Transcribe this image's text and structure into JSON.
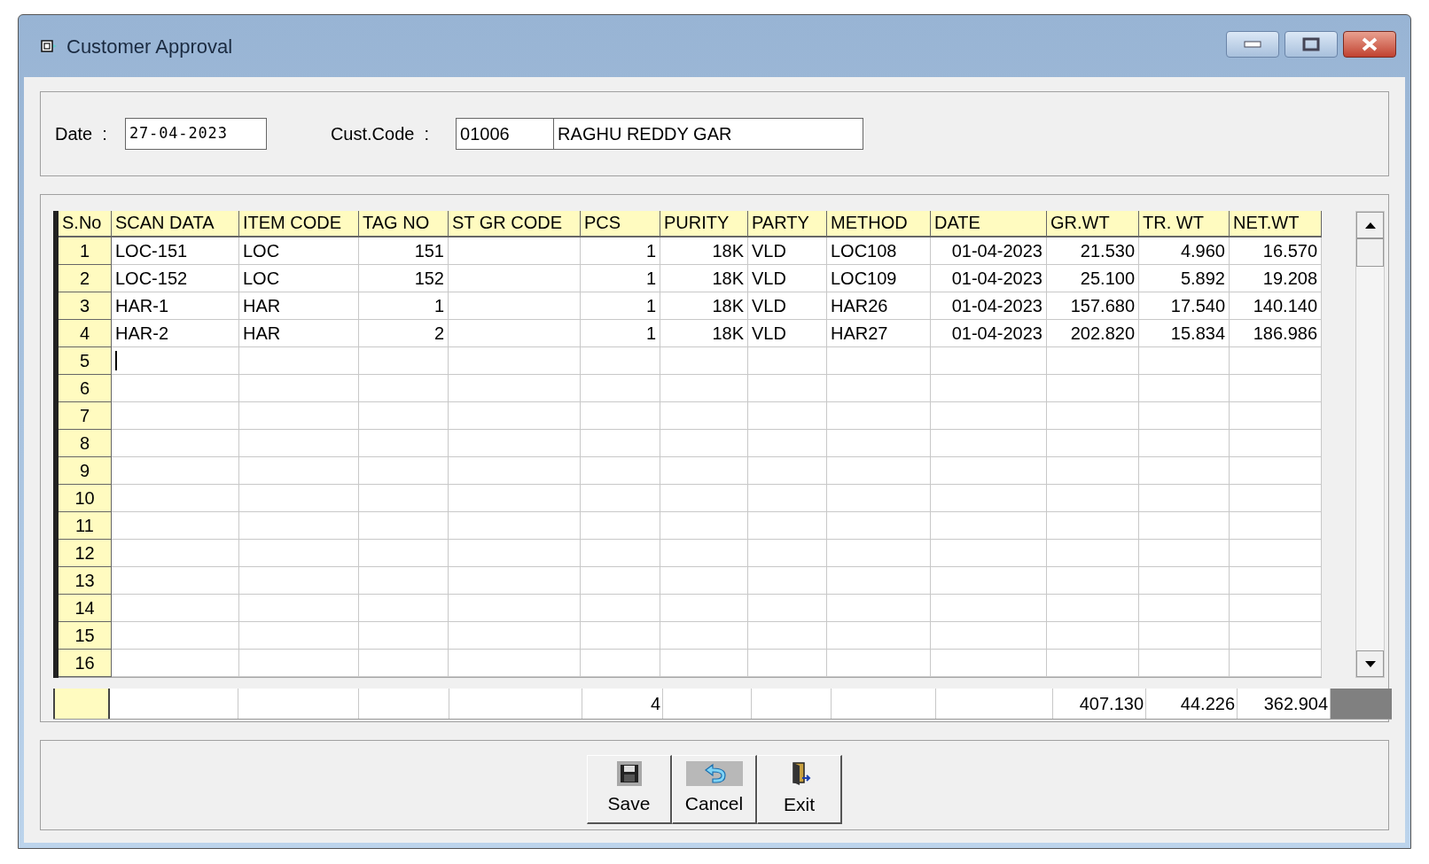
{
  "window": {
    "title": "Customer Approval"
  },
  "header": {
    "date_label": "Date  :",
    "date": "27-04-2023",
    "cust_label": "Cust.Code  :",
    "cust_code": "01006",
    "cust_name": "RAGHU REDDY GAR"
  },
  "columns": [
    {
      "label": "S.No",
      "kind": "index"
    },
    {
      "label": "SCAN DATA",
      "kind": "text"
    },
    {
      "label": "ITEM CODE",
      "kind": "text"
    },
    {
      "label": "TAG NO",
      "kind": "number"
    },
    {
      "label": "ST GR CODE",
      "kind": "text"
    },
    {
      "label": "PCS",
      "kind": "number",
      "total": "4"
    },
    {
      "label": "PURITY",
      "kind": "number"
    },
    {
      "label": "PARTY",
      "kind": "text"
    },
    {
      "label": "METHOD",
      "kind": "text"
    },
    {
      "label": "DATE",
      "kind": "number"
    },
    {
      "label": "GR.WT",
      "kind": "number",
      "total": "407.130"
    },
    {
      "label": "TR. WT",
      "kind": "number",
      "total": "44.226"
    },
    {
      "label": "NET.WT",
      "kind": "number",
      "total": "362.904"
    }
  ],
  "rows": [
    {
      "cells": [
        "1",
        "LOC-151",
        "LOC",
        "151",
        null,
        "1",
        "18K",
        "VLD",
        "LOC108",
        "01-04-2023",
        "21.530",
        "4.960",
        "16.570"
      ],
      "editing": false
    },
    {
      "cells": [
        "2",
        "LOC-152",
        "LOC",
        "152",
        null,
        "1",
        "18K",
        "VLD",
        "LOC109",
        "01-04-2023",
        "25.100",
        "5.892",
        "19.208"
      ],
      "editing": false
    },
    {
      "cells": [
        "3",
        "HAR-1",
        "HAR",
        "1",
        null,
        "1",
        "18K",
        "VLD",
        "HAR26",
        "01-04-2023",
        "157.680",
        "17.540",
        "140.140"
      ],
      "editing": false
    },
    {
      "cells": [
        "4",
        "HAR-2",
        "HAR",
        "2",
        null,
        "1",
        "18K",
        "VLD",
        "HAR27",
        "01-04-2023",
        "202.820",
        "15.834",
        "186.986"
      ],
      "editing": false
    },
    {
      "cells": [
        "5"
      ],
      "editing": true
    },
    {
      "cells": [
        "6"
      ],
      "editing": false
    },
    {
      "cells": [
        "7"
      ],
      "editing": false
    },
    {
      "cells": [
        "8"
      ],
      "editing": false
    },
    {
      "cells": [
        "9"
      ],
      "editing": false
    },
    {
      "cells": [
        "10"
      ],
      "editing": false
    },
    {
      "cells": [
        "11"
      ],
      "editing": false
    },
    {
      "cells": [
        "12"
      ],
      "editing": false
    },
    {
      "cells": [
        "13"
      ],
      "editing": false
    },
    {
      "cells": [
        "14"
      ],
      "editing": false
    },
    {
      "cells": [
        "15"
      ],
      "editing": false
    },
    {
      "cells": [
        "16"
      ],
      "editing": false
    }
  ],
  "buttons": [
    {
      "kind": "save",
      "label": "Save"
    },
    {
      "kind": "cancel",
      "label": "Cancel"
    },
    {
      "kind": "exit",
      "label": "Exit"
    }
  ]
}
